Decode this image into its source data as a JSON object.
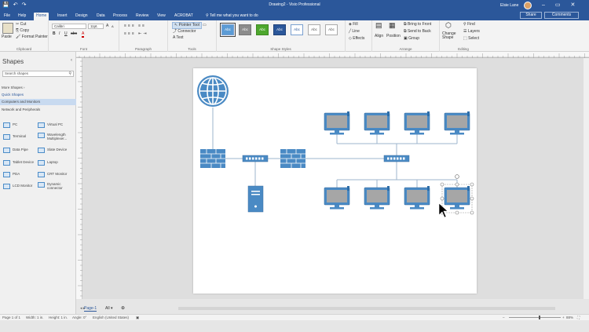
{
  "window": {
    "title": "Drawing2 - Visio Professional",
    "user": "Elsie Lane",
    "minimize": "–",
    "restore": "▭",
    "close": "✕"
  },
  "qat": {
    "save": "💾",
    "undo": "↶",
    "redo": "↷"
  },
  "tabs": [
    "File",
    "Help",
    "Home",
    "Insert",
    "Design",
    "Data",
    "Process",
    "Review",
    "View",
    "ACROBAT"
  ],
  "active_tab": "Home",
  "tell_me": "Tell me what you want to do",
  "share": "Share",
  "comments": "Comments",
  "ribbon": {
    "clipboard": {
      "paste": "Paste",
      "cut": "Cut",
      "copy": "Copy",
      "format_painter": "Format Painter",
      "name": "Clipboard"
    },
    "font": {
      "font_name": "Calibri",
      "font_size": "11pt.",
      "name": "Font",
      "bold": "B",
      "italic": "I",
      "underline": "U",
      "abc": "abc",
      "grow": "A",
      "shrink": "A",
      "color": "A"
    },
    "paragraph": {
      "name": "Paragraph"
    },
    "tools": {
      "pointer": "Pointer Tool",
      "connector": "Connector",
      "text": "A  Text",
      "name": "Tools"
    },
    "shape_styles": {
      "swatches": [
        "Abc",
        "Abc",
        "Abc",
        "Abc",
        "Abc",
        "Abc",
        "Abc"
      ],
      "name": "Shape Styles"
    },
    "fill_line": {
      "fill": "Fill",
      "line": "Line",
      "effects": "Effects"
    },
    "arrange": {
      "align": "Align",
      "position": "Position",
      "bring_front": "Bring to Front",
      "send_back": "Send to Back",
      "group": "Group",
      "name": "Arrange"
    },
    "editing": {
      "change_shape": "Change Shape",
      "find": "Find",
      "layers": "Layers",
      "select": "Select",
      "name": "Editing"
    }
  },
  "shapes_panel": {
    "title": "Shapes",
    "search_placeholder": "Search shapes",
    "more_shapes": "More Shapes",
    "quick_shapes": "Quick Shapes",
    "active_stencil": "Computers and Monitors",
    "network_stencil": "Network and Peripherals",
    "items": [
      {
        "label": "PC"
      },
      {
        "label": "Virtual PC"
      },
      {
        "label": "Terminal"
      },
      {
        "label": "Wavelength Multiplexer..."
      },
      {
        "label": "Data Pipe"
      },
      {
        "label": "Slate Device"
      },
      {
        "label": "Tablet Device"
      },
      {
        "label": "Laptop"
      },
      {
        "label": "PDA"
      },
      {
        "label": "CRT Monitor"
      },
      {
        "label": "LCD Monitor"
      },
      {
        "label": "Dynamic connector"
      }
    ]
  },
  "page_tabs": {
    "page": "Page-1",
    "all": "All ▾",
    "add": "⊕"
  },
  "status": {
    "page": "Page 1 of 1",
    "width": "Width: 1 in.",
    "height": "Height: 1 in.",
    "angle": "Angle: 0°",
    "language": "English (United States)",
    "zoom": "88%"
  },
  "colors": {
    "brand": "#2b579a",
    "shape_blue": "#4a8ac4",
    "screen_gray": "#a6a6a6"
  }
}
